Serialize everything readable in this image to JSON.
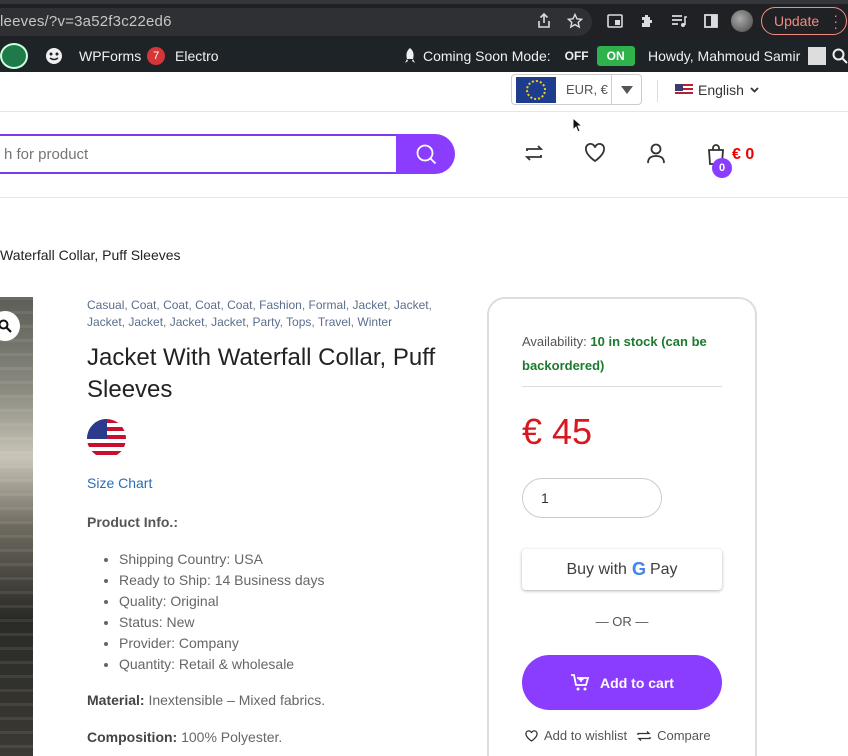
{
  "browser": {
    "url": "leeves/?v=3a52f3c22ed6",
    "update_label": "Update"
  },
  "admin_bar": {
    "wpforms_label": "WPForms",
    "wpforms_count": "7",
    "site_label": "Electro",
    "coming_soon_label": "Coming Soon Mode:",
    "off_label": "OFF",
    "on_label": "ON",
    "howdy_label": "Howdy, Mahmoud Samir"
  },
  "topbar": {
    "currency_label": "EUR, €",
    "language_label": "English"
  },
  "header": {
    "search_placeholder": "h for product",
    "cart_count": "0",
    "cart_total": "€ 0"
  },
  "breadcrumb": {
    "current": "Waterfall Collar, Puff Sleeves"
  },
  "product": {
    "tags": [
      "Casual",
      "Coat",
      "Coat",
      "Coat",
      "Coat",
      "Fashion",
      "Formal",
      "Jacket",
      "Jacket",
      "Jacket",
      "Jacket",
      "Jacket",
      "Jacket",
      "Party",
      "Tops",
      "Travel",
      "Winter"
    ],
    "title": "Jacket With Waterfall Collar, Puff Sleeves",
    "size_chart_label": "Size Chart",
    "info_heading": "Product Info.:",
    "info_items": [
      "Shipping Country: USA",
      "Ready to Ship: 14 Business days",
      "Quality: Original",
      "Status: New",
      "Provider: Company",
      "Quantity: Retail & wholesale"
    ],
    "material_label": "Material:",
    "material_value": "Inextensible – Mixed fabrics.",
    "composition_label": "Composition:",
    "composition_value": "100% Polyester."
  },
  "buy_box": {
    "availability_label": "Availability:",
    "availability_value": "10 in stock (can be backordered)",
    "price": "€ 45",
    "quantity": "1",
    "gpay_prefix": "Buy with",
    "gpay_g": "G",
    "gpay_suffix": "Pay",
    "or_label": "— OR —",
    "add_to_cart_label": "Add to cart",
    "wishlist_label": "Add to wishlist",
    "compare_label": "Compare"
  },
  "colors": {
    "accent": "#8b3dff",
    "price": "#d8171f",
    "stock": "#1a7a2e",
    "admin_bar": "#1d2327"
  }
}
